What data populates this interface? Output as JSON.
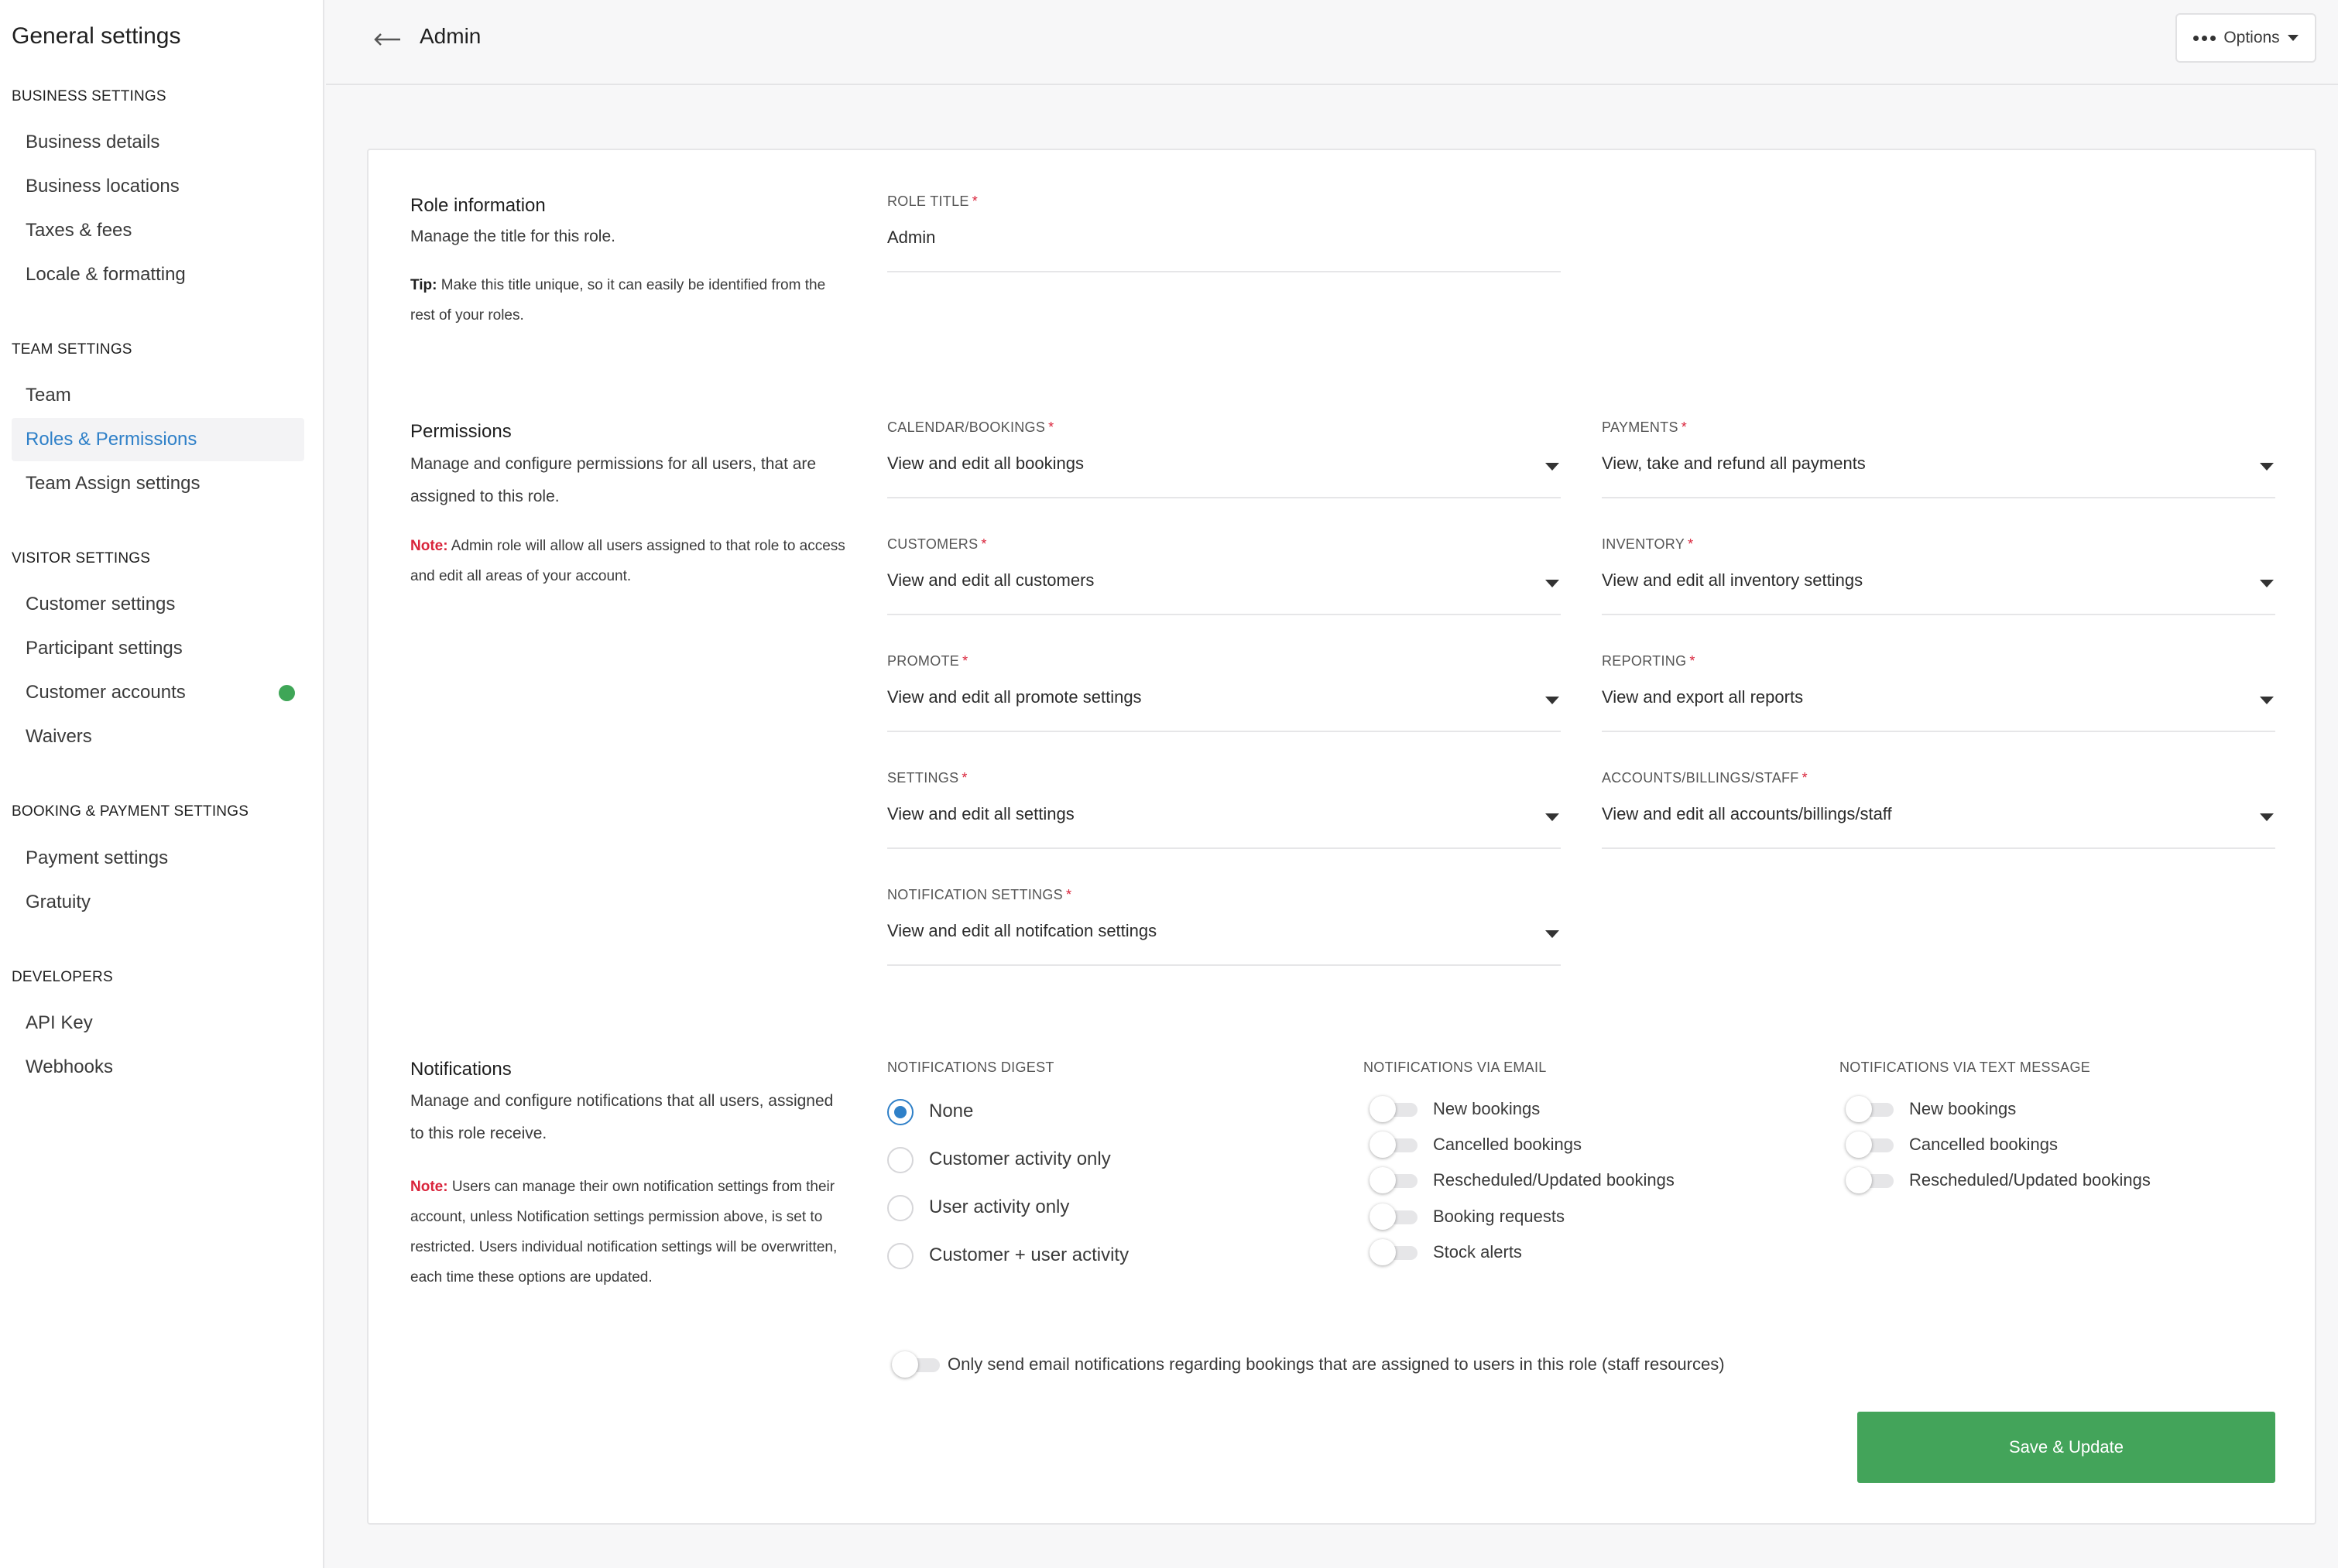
{
  "sidebar": {
    "title": "General settings",
    "sections": [
      {
        "heading": "BUSINESS SETTINGS",
        "items": [
          "Business details",
          "Business locations",
          "Taxes & fees",
          "Locale & formatting"
        ]
      },
      {
        "heading": "TEAM SETTINGS",
        "items": [
          "Team",
          "Roles & Permissions",
          "Team Assign settings"
        ]
      },
      {
        "heading": "VISITOR SETTINGS",
        "items": [
          "Customer settings",
          "Participant settings",
          "Customer accounts",
          "Waivers"
        ]
      },
      {
        "heading": "BOOKING & PAYMENT SETTINGS",
        "items": [
          "Payment settings",
          "Gratuity"
        ]
      },
      {
        "heading": "DEVELOPERS",
        "items": [
          "API Key",
          "Webhooks"
        ]
      }
    ],
    "active_item": "Roles & Permissions",
    "status_dot_color": "#3fa657"
  },
  "header": {
    "back_icon": "arrow-left-icon",
    "title": "Admin",
    "options_label": "Options"
  },
  "role_info": {
    "title": "Role information",
    "description": "Manage the title for this role.",
    "tip_label": "Tip:",
    "tip_text": "Make this title unique, so it can easily be identified from the rest of your roles.",
    "field_label": "ROLE TITLE",
    "field_value": "Admin"
  },
  "permissions": {
    "title": "Permissions",
    "description": "Manage and configure permissions for all users, that are assigned to this role.",
    "note_label": "Note:",
    "note_text": "Admin role will allow all users assigned to that role to access and edit all areas of your account.",
    "fields": [
      {
        "label": "CALENDAR/BOOKINGS",
        "value": "View and edit all bookings"
      },
      {
        "label": "PAYMENTS",
        "value": "View, take and refund all payments"
      },
      {
        "label": "CUSTOMERS",
        "value": "View and edit all customers"
      },
      {
        "label": "INVENTORY",
        "value": "View and edit all inventory settings"
      },
      {
        "label": "PROMOTE",
        "value": "View and edit all promote settings"
      },
      {
        "label": "REPORTING",
        "value": "View and export all reports"
      },
      {
        "label": "SETTINGS",
        "value": "View and edit all settings"
      },
      {
        "label": "ACCOUNTS/BILLINGS/STAFF",
        "value": "View and edit all accounts/billings/staff"
      },
      {
        "label": "NOTIFICATION SETTINGS",
        "value": "View and edit all notifcation settings"
      }
    ]
  },
  "notifications": {
    "title": "Notifications",
    "description": "Manage and configure notifications that all users, assigned to this role receive.",
    "note_label": "Note:",
    "note_text": "Users can manage their own notification settings from their account, unless Notification settings permission above, is set to restricted. Users individual notification settings will be overwritten, each time these options are updated.",
    "digest_heading": "NOTIFICATIONS DIGEST",
    "digest_options": [
      "None",
      "Customer activity only",
      "User activity only",
      "Customer + user activity"
    ],
    "digest_selected": "None",
    "email_heading": "NOTIFICATIONS VIA EMAIL",
    "email_options": [
      "New bookings",
      "Cancelled bookings",
      "Rescheduled/Updated bookings",
      "Booking requests",
      "Stock alerts"
    ],
    "text_heading": "NOTIFICATIONS VIA TEXT MESSAGE",
    "text_options": [
      "New bookings",
      "Cancelled bookings",
      "Rescheduled/Updated bookings"
    ],
    "staff_only_label": "Only send email notifications regarding bookings that are assigned to users in this role (staff resources)"
  },
  "actions": {
    "save_label": "Save & Update",
    "save_color": "#43a45a"
  }
}
